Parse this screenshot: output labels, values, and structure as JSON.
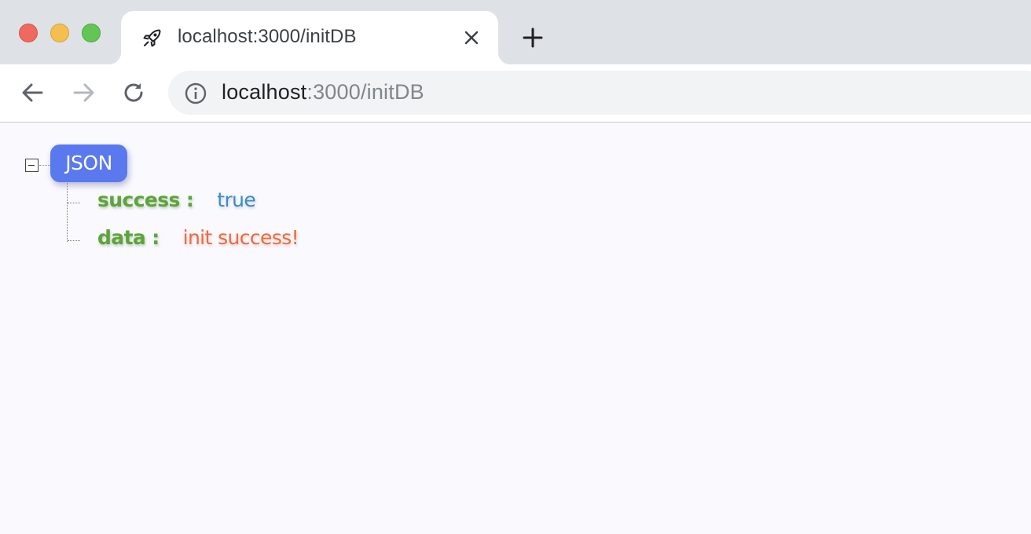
{
  "window": {
    "traffic_lights": [
      "close",
      "minimize",
      "maximize"
    ]
  },
  "tab": {
    "title": "localhost:3000/initDB",
    "favicon": "rocket-icon"
  },
  "toolbar": {
    "back_icon": "arrow-left-icon",
    "forward_icon": "arrow-right-icon",
    "reload_icon": "reload-icon",
    "url_host": "localhost",
    "url_path": ":3000/initDB"
  },
  "json_viewer": {
    "root_label": "JSON",
    "entries": [
      {
        "key": "success",
        "separator": ":",
        "value": "true",
        "value_type": "boolean"
      },
      {
        "key": "data",
        "separator": ":",
        "value": "init success!",
        "value_type": "string"
      }
    ]
  },
  "colors": {
    "badge": "#5b79ee",
    "key": "#5da43a",
    "boolean": "#3d8cc4",
    "string": "#ee6a3c",
    "page_background": "#f9f9fe"
  }
}
